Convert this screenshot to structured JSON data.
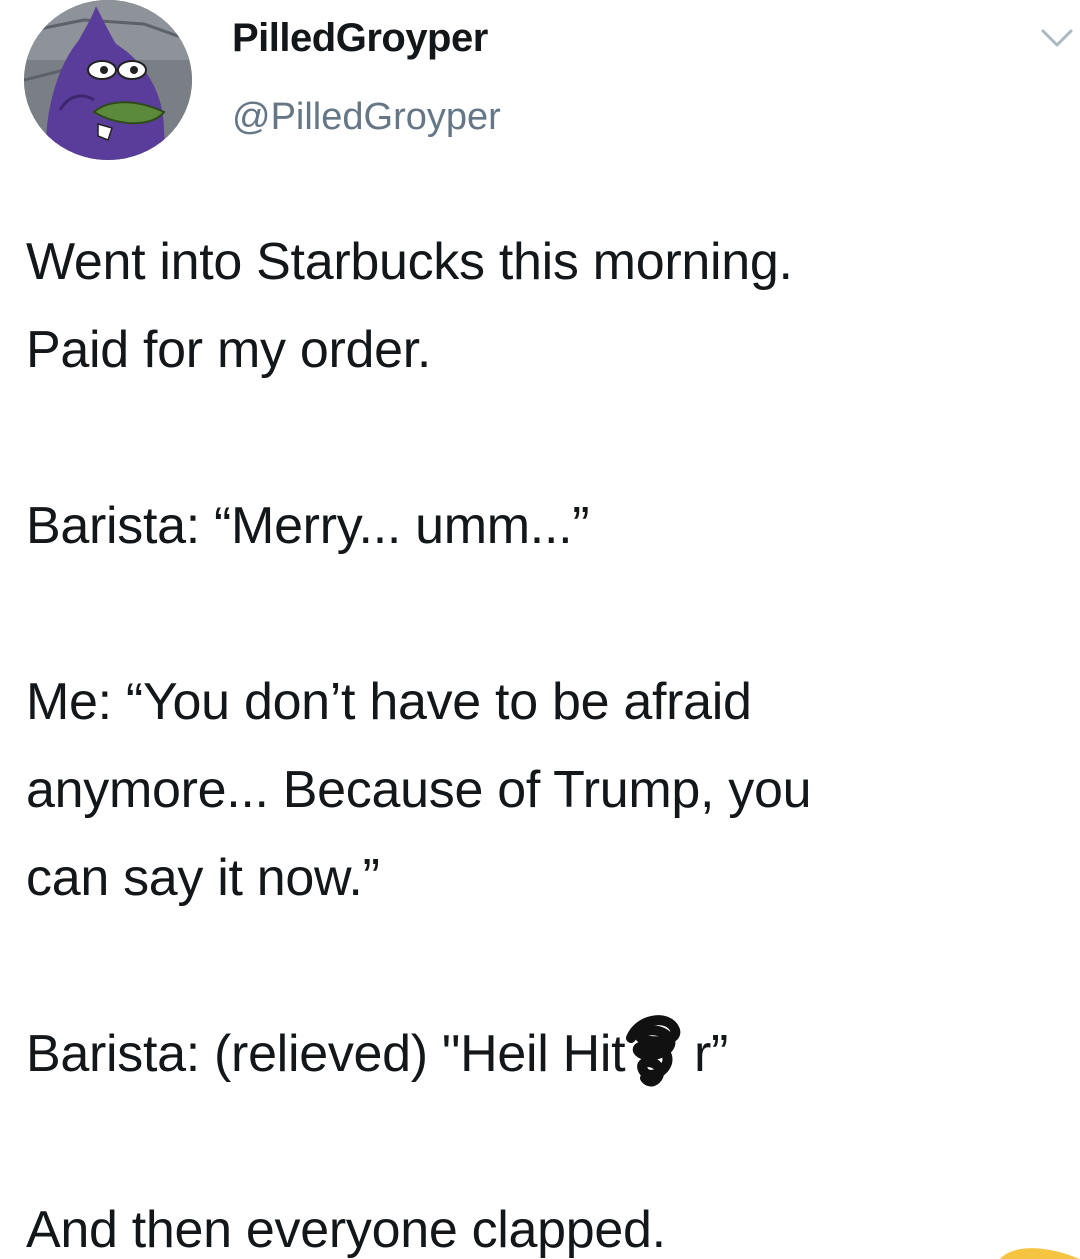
{
  "author": {
    "display_name": "PilledGroyper",
    "handle": "@PilledGroyper",
    "avatar_icon": "purple-cartoon-character-avatar"
  },
  "menu_icon": "chevron-down-icon",
  "tweet": {
    "lines": [
      "Went into Starbucks this morning.",
      "Paid for my order.",
      "Barista: “Merry... umm...”",
      "Me: “You don’t have to be afraid",
      "anymore... Because of Trump, you",
      "can say it now.”",
      "Barista: (relieved) \"Heil Hit",
      "r”",
      "And then everyone clapped."
    ]
  },
  "colors": {
    "text": "#14171a",
    "secondary_text": "#657786",
    "avatar_purple": "#5a3d9a",
    "corner_mark": "#f5c542"
  }
}
